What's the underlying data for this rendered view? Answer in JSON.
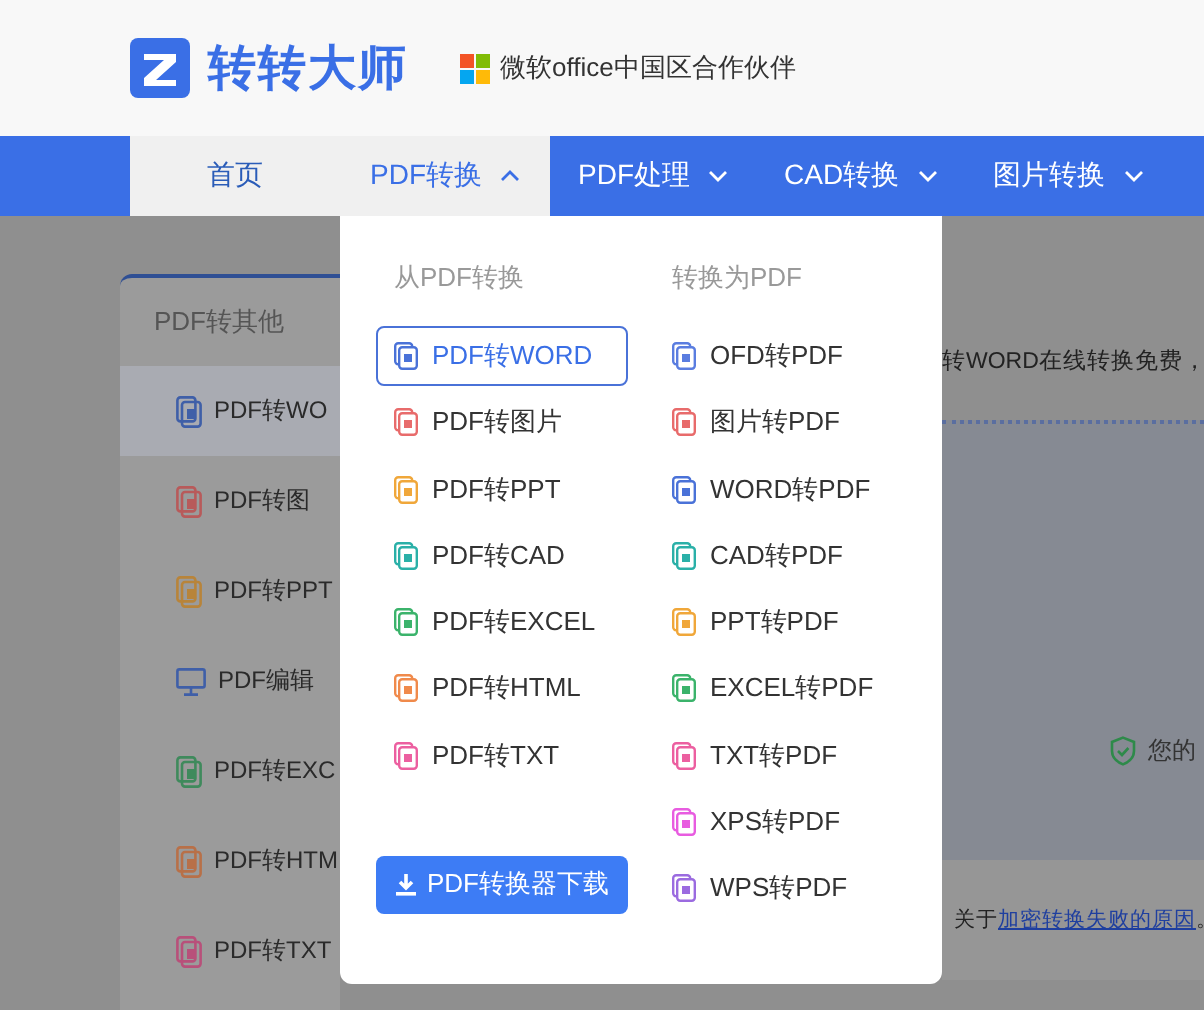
{
  "header": {
    "logo_text": "转转大师",
    "partner": "微软office中国区合作伙伴"
  },
  "nav": [
    {
      "label": "首页",
      "selected": true
    },
    {
      "label": "PDF转换",
      "selected": false,
      "expanded": true
    },
    {
      "label": "PDF处理",
      "selected": false,
      "expanded": false
    },
    {
      "label": "CAD转换",
      "selected": false,
      "expanded": false
    },
    {
      "label": "图片转换",
      "selected": false,
      "expanded": false
    }
  ],
  "sidebar": {
    "title": "PDF转其他",
    "items": [
      {
        "label": "PDF转WO",
        "kind": "doc",
        "color": "#3f5fa8",
        "selected": true
      },
      {
        "label": "PDF转图",
        "kind": "doc",
        "color": "#b85a5a",
        "selected": false
      },
      {
        "label": "PDF转PPT",
        "kind": "doc",
        "color": "#b8843a",
        "selected": false
      },
      {
        "label": "PDF编辑",
        "kind": "monitor",
        "color": "#3f5fa8",
        "selected": false
      },
      {
        "label": "PDF转EXC",
        "kind": "doc",
        "color": "#3f8a5c",
        "selected": false
      },
      {
        "label": "PDF转HTM",
        "kind": "doc",
        "color": "#b87048",
        "selected": false
      },
      {
        "label": "PDF转TXT",
        "kind": "doc",
        "color": "#b8507a",
        "selected": false
      }
    ]
  },
  "menu": {
    "columns": [
      {
        "heading": "从PDF转换",
        "items": [
          {
            "label": "PDF转WORD",
            "color": "#4a72d8",
            "selected": true
          },
          {
            "label": "PDF转图片",
            "color": "#e86b6b",
            "selected": false
          },
          {
            "label": "PDF转PPT",
            "color": "#f0a73a",
            "selected": false
          },
          {
            "label": "PDF转CAD",
            "color": "#2ab0a8",
            "selected": false
          },
          {
            "label": "PDF转EXCEL",
            "color": "#3bb36b",
            "selected": false
          },
          {
            "label": "PDF转HTML",
            "color": "#f08a4b",
            "selected": false
          },
          {
            "label": "PDF转TXT",
            "color": "#ec5fa0",
            "selected": false
          }
        ]
      },
      {
        "heading": "转换为PDF",
        "items": [
          {
            "label": "OFD转PDF",
            "color": "#5a7de0",
            "selected": false
          },
          {
            "label": "图片转PDF",
            "color": "#e86b6b",
            "selected": false
          },
          {
            "label": "WORD转PDF",
            "color": "#4a72d8",
            "selected": false
          },
          {
            "label": "CAD转PDF",
            "color": "#2ab0a8",
            "selected": false
          },
          {
            "label": "PPT转PDF",
            "color": "#f0a73a",
            "selected": false
          },
          {
            "label": "EXCEL转PDF",
            "color": "#3bb36b",
            "selected": false
          },
          {
            "label": "TXT转PDF",
            "color": "#ec5fa0",
            "selected": false
          },
          {
            "label": "XPS转PDF",
            "color": "#e85ce0",
            "selected": false
          },
          {
            "label": "WPS转PDF",
            "color": "#9b6be0",
            "selected": false
          }
        ]
      }
    ],
    "download_button": "PDF转换器下载"
  },
  "content": {
    "intro": "转WORD在线转换免费，",
    "security_note": "您的",
    "help_prefix": "关于",
    "help_link": "加密转换失败的原因",
    "help_suffix": "。"
  }
}
